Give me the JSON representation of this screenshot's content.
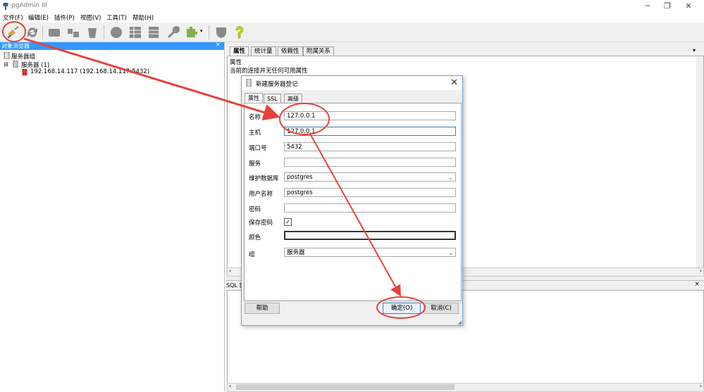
{
  "window": {
    "title": "pgAdmin III"
  },
  "menu": [
    "文件(F)",
    "编辑(E)",
    "插件(P)",
    "视图(V)",
    "工具(T)",
    "帮助(H)"
  ],
  "left_panel": {
    "header": "对象浏览器",
    "close": "×",
    "tree": {
      "root": "服务器组",
      "group": "服务器 (1)",
      "server": "192.168.14.117 (192.168.14.117:5432)"
    }
  },
  "right_panel": {
    "tabs": [
      "属性",
      "统计量",
      "依赖性",
      "附属关系"
    ],
    "properties_title": "属性",
    "properties_message": "当前的连接并无任何可用属性",
    "sql_header": "SQL 窗格",
    "close": "×"
  },
  "dialog": {
    "title": "新建服务器登记",
    "close": "✕",
    "tabs": [
      "属性",
      "SSL",
      "高级"
    ],
    "fields": {
      "name": {
        "label": "名称",
        "value": "127.0.0.1"
      },
      "host": {
        "label": "主机",
        "value": "127.0.0.1"
      },
      "port": {
        "label": "端口号",
        "value": "5432"
      },
      "service": {
        "label": "服务",
        "value": ""
      },
      "maintenance_db": {
        "label": "维护数据库",
        "value": "postgres"
      },
      "username": {
        "label": "用户名称",
        "value": "postgres"
      },
      "password": {
        "label": "密码",
        "value": ""
      },
      "save_password": {
        "label": "保存密码",
        "checked": true
      },
      "color": {
        "label": "颜色",
        "value": ""
      },
      "group": {
        "label": "组",
        "value": "服务器"
      }
    },
    "buttons": {
      "help": "帮助",
      "ok": "确定(O)",
      "cancel": "取消(C)"
    }
  },
  "colors": {
    "annotation": "#e8423a",
    "selection": "#3399ff"
  },
  "icons": [
    "connect-plug-icon",
    "refresh-icon",
    "help-question-icon",
    "window-minimize-icon",
    "window-restore-icon",
    "window-close-icon"
  ]
}
